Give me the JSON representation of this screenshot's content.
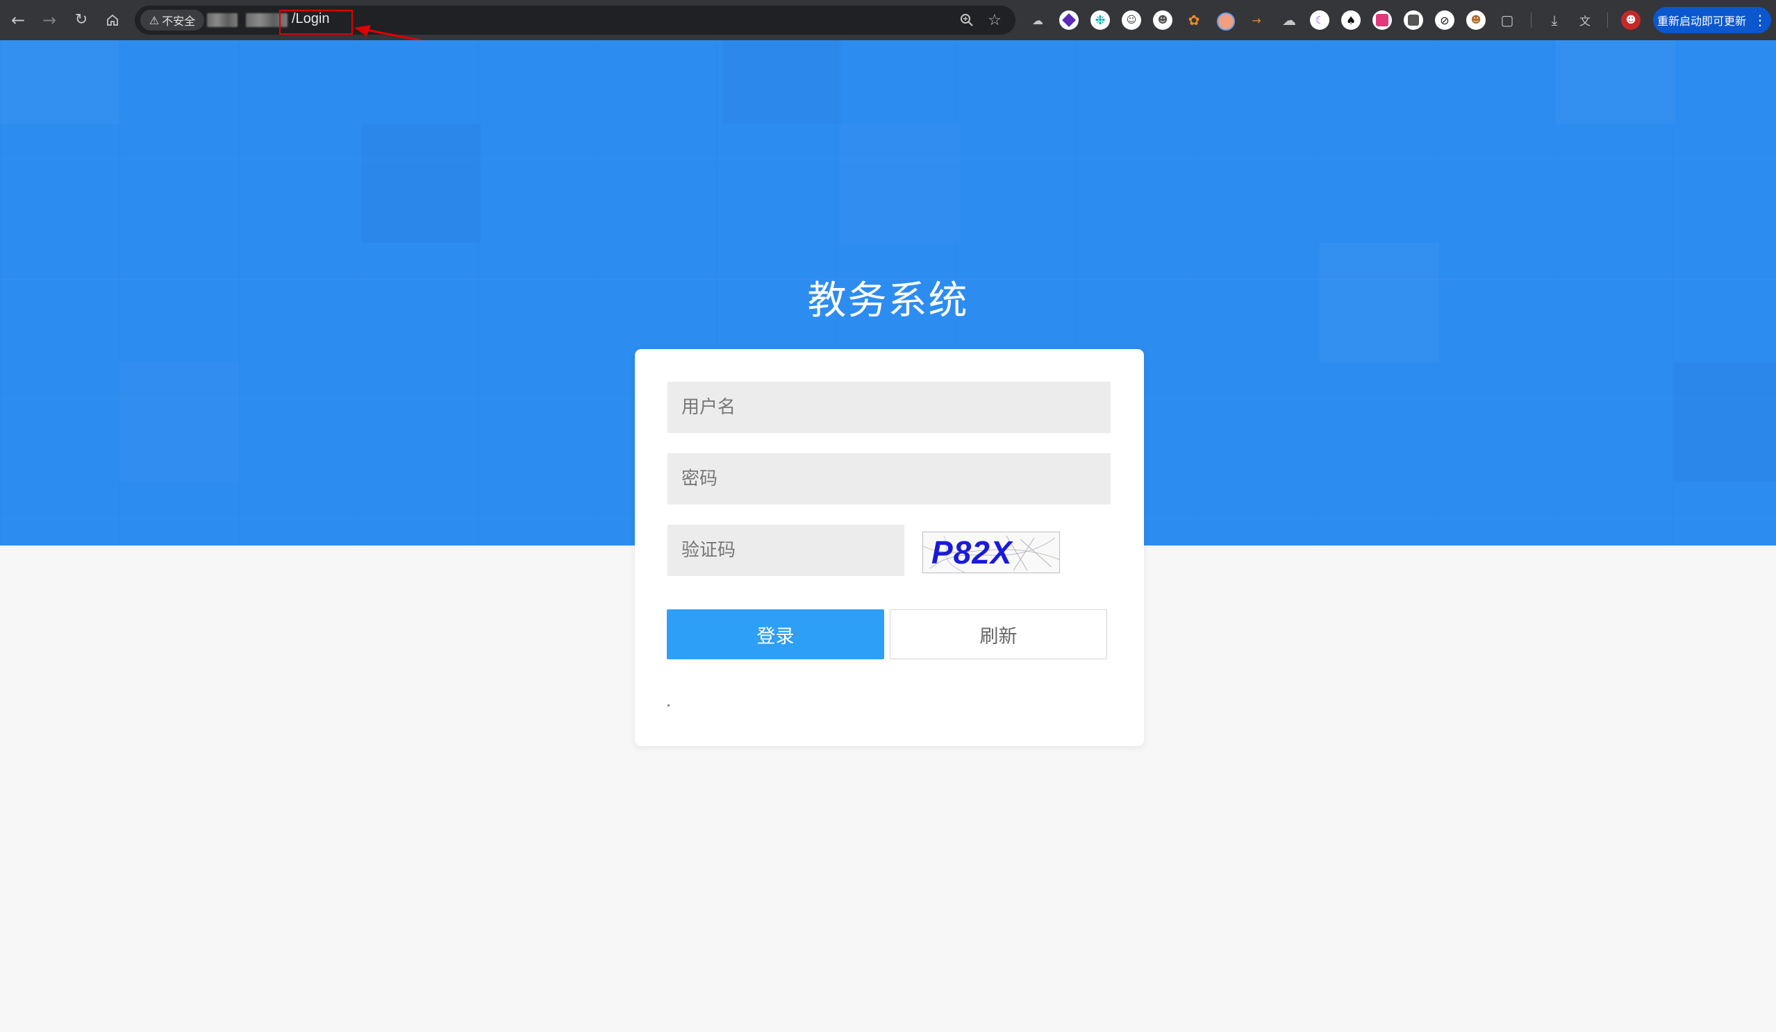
{
  "browser": {
    "security_label": "不安全",
    "url_path": "/Login",
    "update_button_label": "重新启动即可更新",
    "icons": [
      "back-icon",
      "forward-icon",
      "reload-icon",
      "home-icon",
      "warning-icon",
      "zoom-icon",
      "bookmark-star-icon",
      "extensions-puzzle-icon",
      "download-icon",
      "translate-icon",
      "profile-icon",
      "menu-kebab-icon"
    ],
    "annotation_color": "#e00000"
  },
  "page": {
    "title": "教务系统",
    "hero_color": "#2d8cf0",
    "login_form": {
      "username_placeholder": "用户名",
      "password_placeholder": "密码",
      "captcha_placeholder": "验证码",
      "captcha_text": "P82X",
      "login_button": "登录",
      "refresh_button": "刷新"
    }
  }
}
